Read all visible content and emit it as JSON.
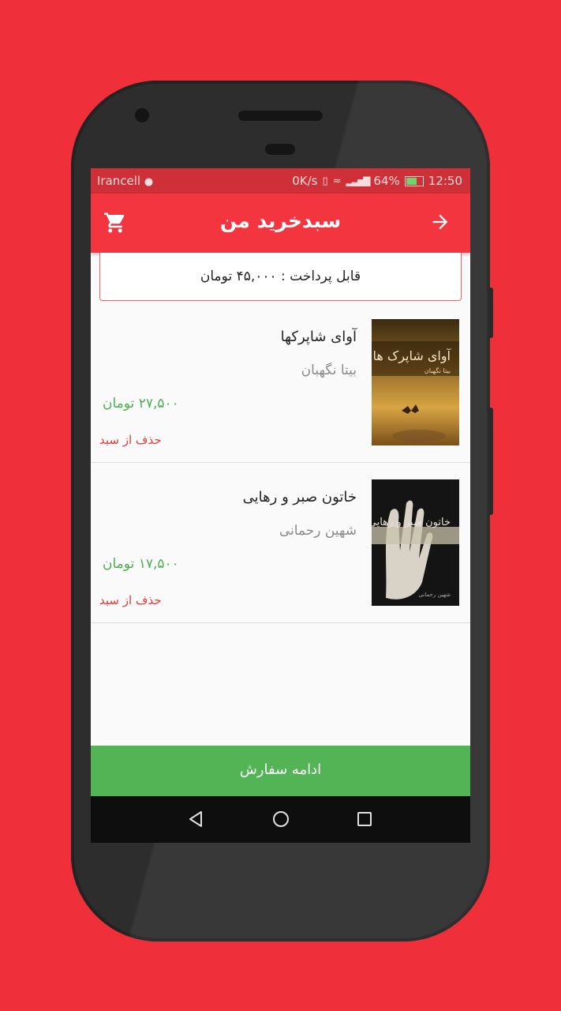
{
  "statusbar": {
    "carrier": "Irancell",
    "speed": "0K/s",
    "battery": "64%",
    "time": "12:50"
  },
  "appbar": {
    "title": "سبدخرید من",
    "cart_icon": "cart-icon",
    "back_icon": "arrow-right-icon"
  },
  "summary": {
    "payable": "قابل پرداخت : ۴۵,۰۰۰ تومان"
  },
  "cart": {
    "items": [
      {
        "title": "آوای شاپرکها",
        "author": "بیتا نگهبان",
        "price": "۲۷,۵۰۰ تومان",
        "remove": "حذف از سبد",
        "cover_text": "آوای شاپرک ها",
        "cover_author": "بیتا نگهبان"
      },
      {
        "title": "خاتون صبر و رهایی",
        "author": "شهین رحمانی",
        "price": "۱۷,۵۰۰ تومان",
        "remove": "حذف از سبد",
        "cover_text": "خاتون صبر و رهایی",
        "cover_author": "شهین رحمانی"
      }
    ]
  },
  "footer": {
    "continue_label": "ادامه سفارش"
  },
  "colors": {
    "background": "#ef2f39",
    "appbar": "#f2353f",
    "price": "#4caf50",
    "remove": "#e53935",
    "continue": "#53b455"
  }
}
